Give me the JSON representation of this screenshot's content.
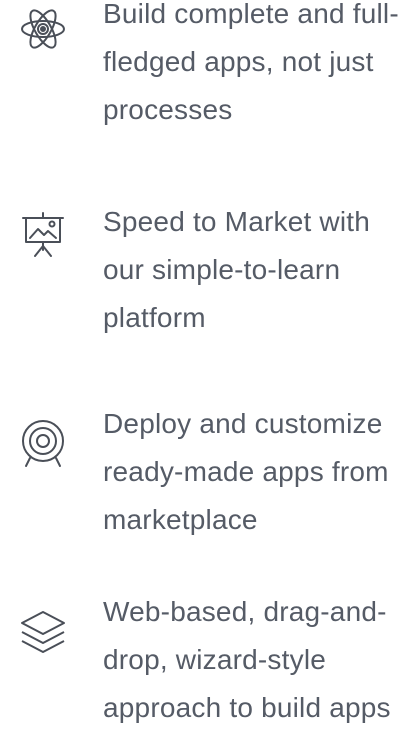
{
  "features": [
    {
      "icon": "atom-icon",
      "text": "Build complete and full-\nfledged apps, not just\nprocesses"
    },
    {
      "icon": "presentation-board-icon",
      "text": "Speed to Market with\nour simple-to-learn\nplatform"
    },
    {
      "icon": "target-icon",
      "text": "Deploy and customize\nready-made apps from\nmarketplace"
    },
    {
      "icon": "layers-icon",
      "text": "Web-based, drag-and-\ndrop, wizard-style\napproach to build apps"
    }
  ],
  "colors": {
    "text": "#555b66",
    "icon_stroke": "#4a4f58",
    "background": "#ffffff"
  }
}
